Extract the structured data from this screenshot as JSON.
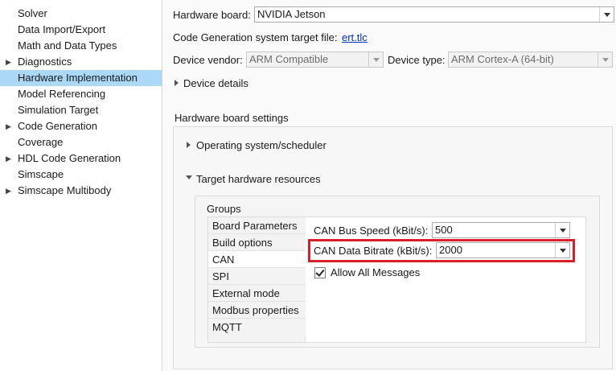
{
  "sidebar": {
    "items": [
      {
        "label": "Solver",
        "expandable": false,
        "selected": false
      },
      {
        "label": "Data Import/Export",
        "expandable": false,
        "selected": false
      },
      {
        "label": "Math and Data Types",
        "expandable": false,
        "selected": false
      },
      {
        "label": "Diagnostics",
        "expandable": true,
        "selected": false
      },
      {
        "label": "Hardware Implementation",
        "expandable": false,
        "selected": true
      },
      {
        "label": "Model Referencing",
        "expandable": false,
        "selected": false
      },
      {
        "label": "Simulation Target",
        "expandable": false,
        "selected": false
      },
      {
        "label": "Code Generation",
        "expandable": true,
        "selected": false
      },
      {
        "label": "Coverage",
        "expandable": false,
        "selected": false
      },
      {
        "label": "HDL Code Generation",
        "expandable": true,
        "selected": false
      },
      {
        "label": "Simscape",
        "expandable": false,
        "selected": false
      },
      {
        "label": "Simscape Multibody",
        "expandable": true,
        "selected": false
      }
    ]
  },
  "main": {
    "hardware_board_label": "Hardware board:",
    "hardware_board_value": "NVIDIA Jetson",
    "target_file_label": "Code Generation system target file:",
    "target_file_link": "ert.tlc",
    "device_vendor_label": "Device vendor:",
    "device_vendor_value": "ARM Compatible",
    "device_type_label": "Device type:",
    "device_type_value": "ARM Cortex-A (64-bit)",
    "device_details_label": "Device details",
    "board_settings_heading": "Hardware board settings",
    "os_scheduler_label": "Operating system/scheduler",
    "target_resources_label": "Target hardware resources",
    "groups_label": "Groups",
    "groups": [
      "Board Parameters",
      "Build options",
      "CAN",
      "SPI",
      "External mode",
      "Modbus properties",
      "MQTT"
    ],
    "active_group": "CAN",
    "can": {
      "bus_speed_label": "CAN Bus Speed (kBit/s):",
      "bus_speed_value": "500",
      "data_bitrate_label": "CAN Data Bitrate (kBit/s):",
      "data_bitrate_value": "2000",
      "allow_all_label": "Allow All Messages",
      "allow_all_checked": true
    }
  },
  "colors": {
    "selected_bg": "#aad8f5",
    "highlight_box": "#d9202a",
    "link": "#0033cc"
  }
}
